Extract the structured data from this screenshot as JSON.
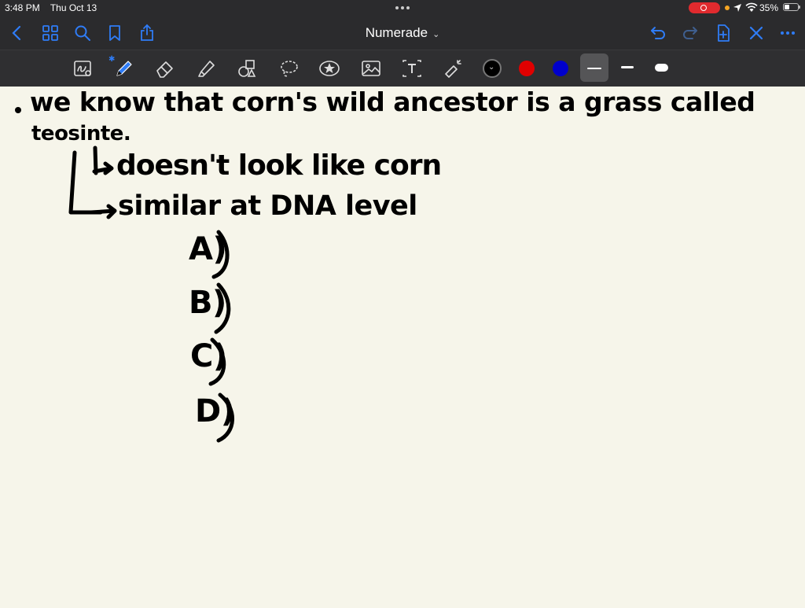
{
  "status_bar": {
    "time": "3:48 PM",
    "date": "Thu Oct 13",
    "battery": "35%",
    "battery_level": 0.35
  },
  "nav": {
    "title": "Numerade"
  },
  "toolbar": {
    "pen_colors": [
      "#000000",
      "#e00000",
      "#0000cc"
    ],
    "selected_color": "#000000",
    "stroke_widths": [
      "thin",
      "medium",
      "thick"
    ],
    "selected_width": "thin"
  },
  "notes": {
    "bullet_line1": "we know that corn's wild ancestor is a grass called",
    "bullet_line2": "teosinte.",
    "sub1": "doesn't look like corn",
    "sub2": "similar at DNA level",
    "options": [
      "A)",
      "B)",
      "C)",
      "D)"
    ]
  }
}
